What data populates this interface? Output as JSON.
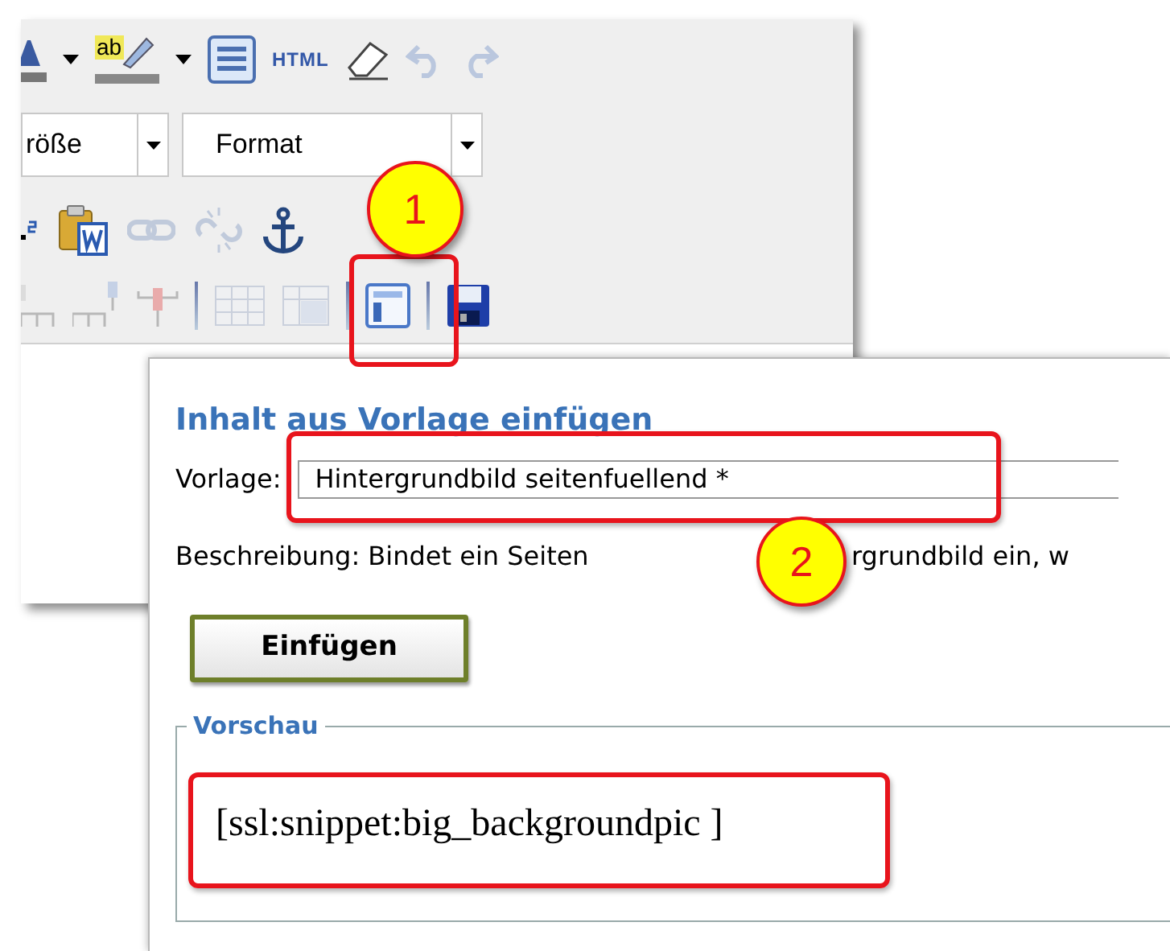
{
  "editor": {
    "toolbar_rows": [
      [
        {
          "kind": "font-color",
          "disabled": false
        },
        {
          "kind": "caret"
        },
        {
          "kind": "highlight",
          "disabled": false,
          "label": "ab"
        },
        {
          "kind": "caret"
        },
        {
          "kind": "source",
          "disabled": false
        },
        {
          "kind": "html",
          "disabled": false,
          "label": "HTML"
        },
        {
          "kind": "eraser",
          "disabled": false
        },
        {
          "kind": "undo",
          "disabled": true
        },
        {
          "kind": "redo",
          "disabled": true
        }
      ],
      [
        {
          "kind": "superscript",
          "disabled": false
        },
        {
          "kind": "paste-word",
          "disabled": false
        },
        {
          "kind": "link",
          "disabled": true
        },
        {
          "kind": "unlink",
          "disabled": true
        },
        {
          "kind": "anchor",
          "disabled": false
        }
      ],
      [
        {
          "kind": "table-part",
          "disabled": true
        },
        {
          "kind": "table-insert",
          "disabled": true
        },
        {
          "kind": "table-split",
          "disabled": true
        },
        {
          "kind": "separator"
        },
        {
          "kind": "table",
          "disabled": true
        },
        {
          "kind": "table-cells",
          "disabled": true
        },
        {
          "kind": "separator"
        },
        {
          "kind": "template",
          "disabled": false
        },
        {
          "kind": "separator"
        },
        {
          "kind": "save",
          "disabled": false
        }
      ]
    ],
    "dropdowns": [
      {
        "value": "röße"
      },
      {
        "value": "Format"
      }
    ]
  },
  "dialog": {
    "title": "Inhalt aus Vorlage einfügen",
    "template_label": "Vorlage:",
    "template_value": "Hintergrundbild seitenfuellend *",
    "description_parts": [
      "Beschreibung: Bindet ein Seiten",
      "rgrundbild ein, w"
    ],
    "insert_button": "Einfügen",
    "preview_legend": "Vorschau",
    "preview_text": "[ssl:snippet:big_backgroundpic ]"
  },
  "callouts": [
    {
      "label": "1"
    },
    {
      "label": "2"
    }
  ]
}
